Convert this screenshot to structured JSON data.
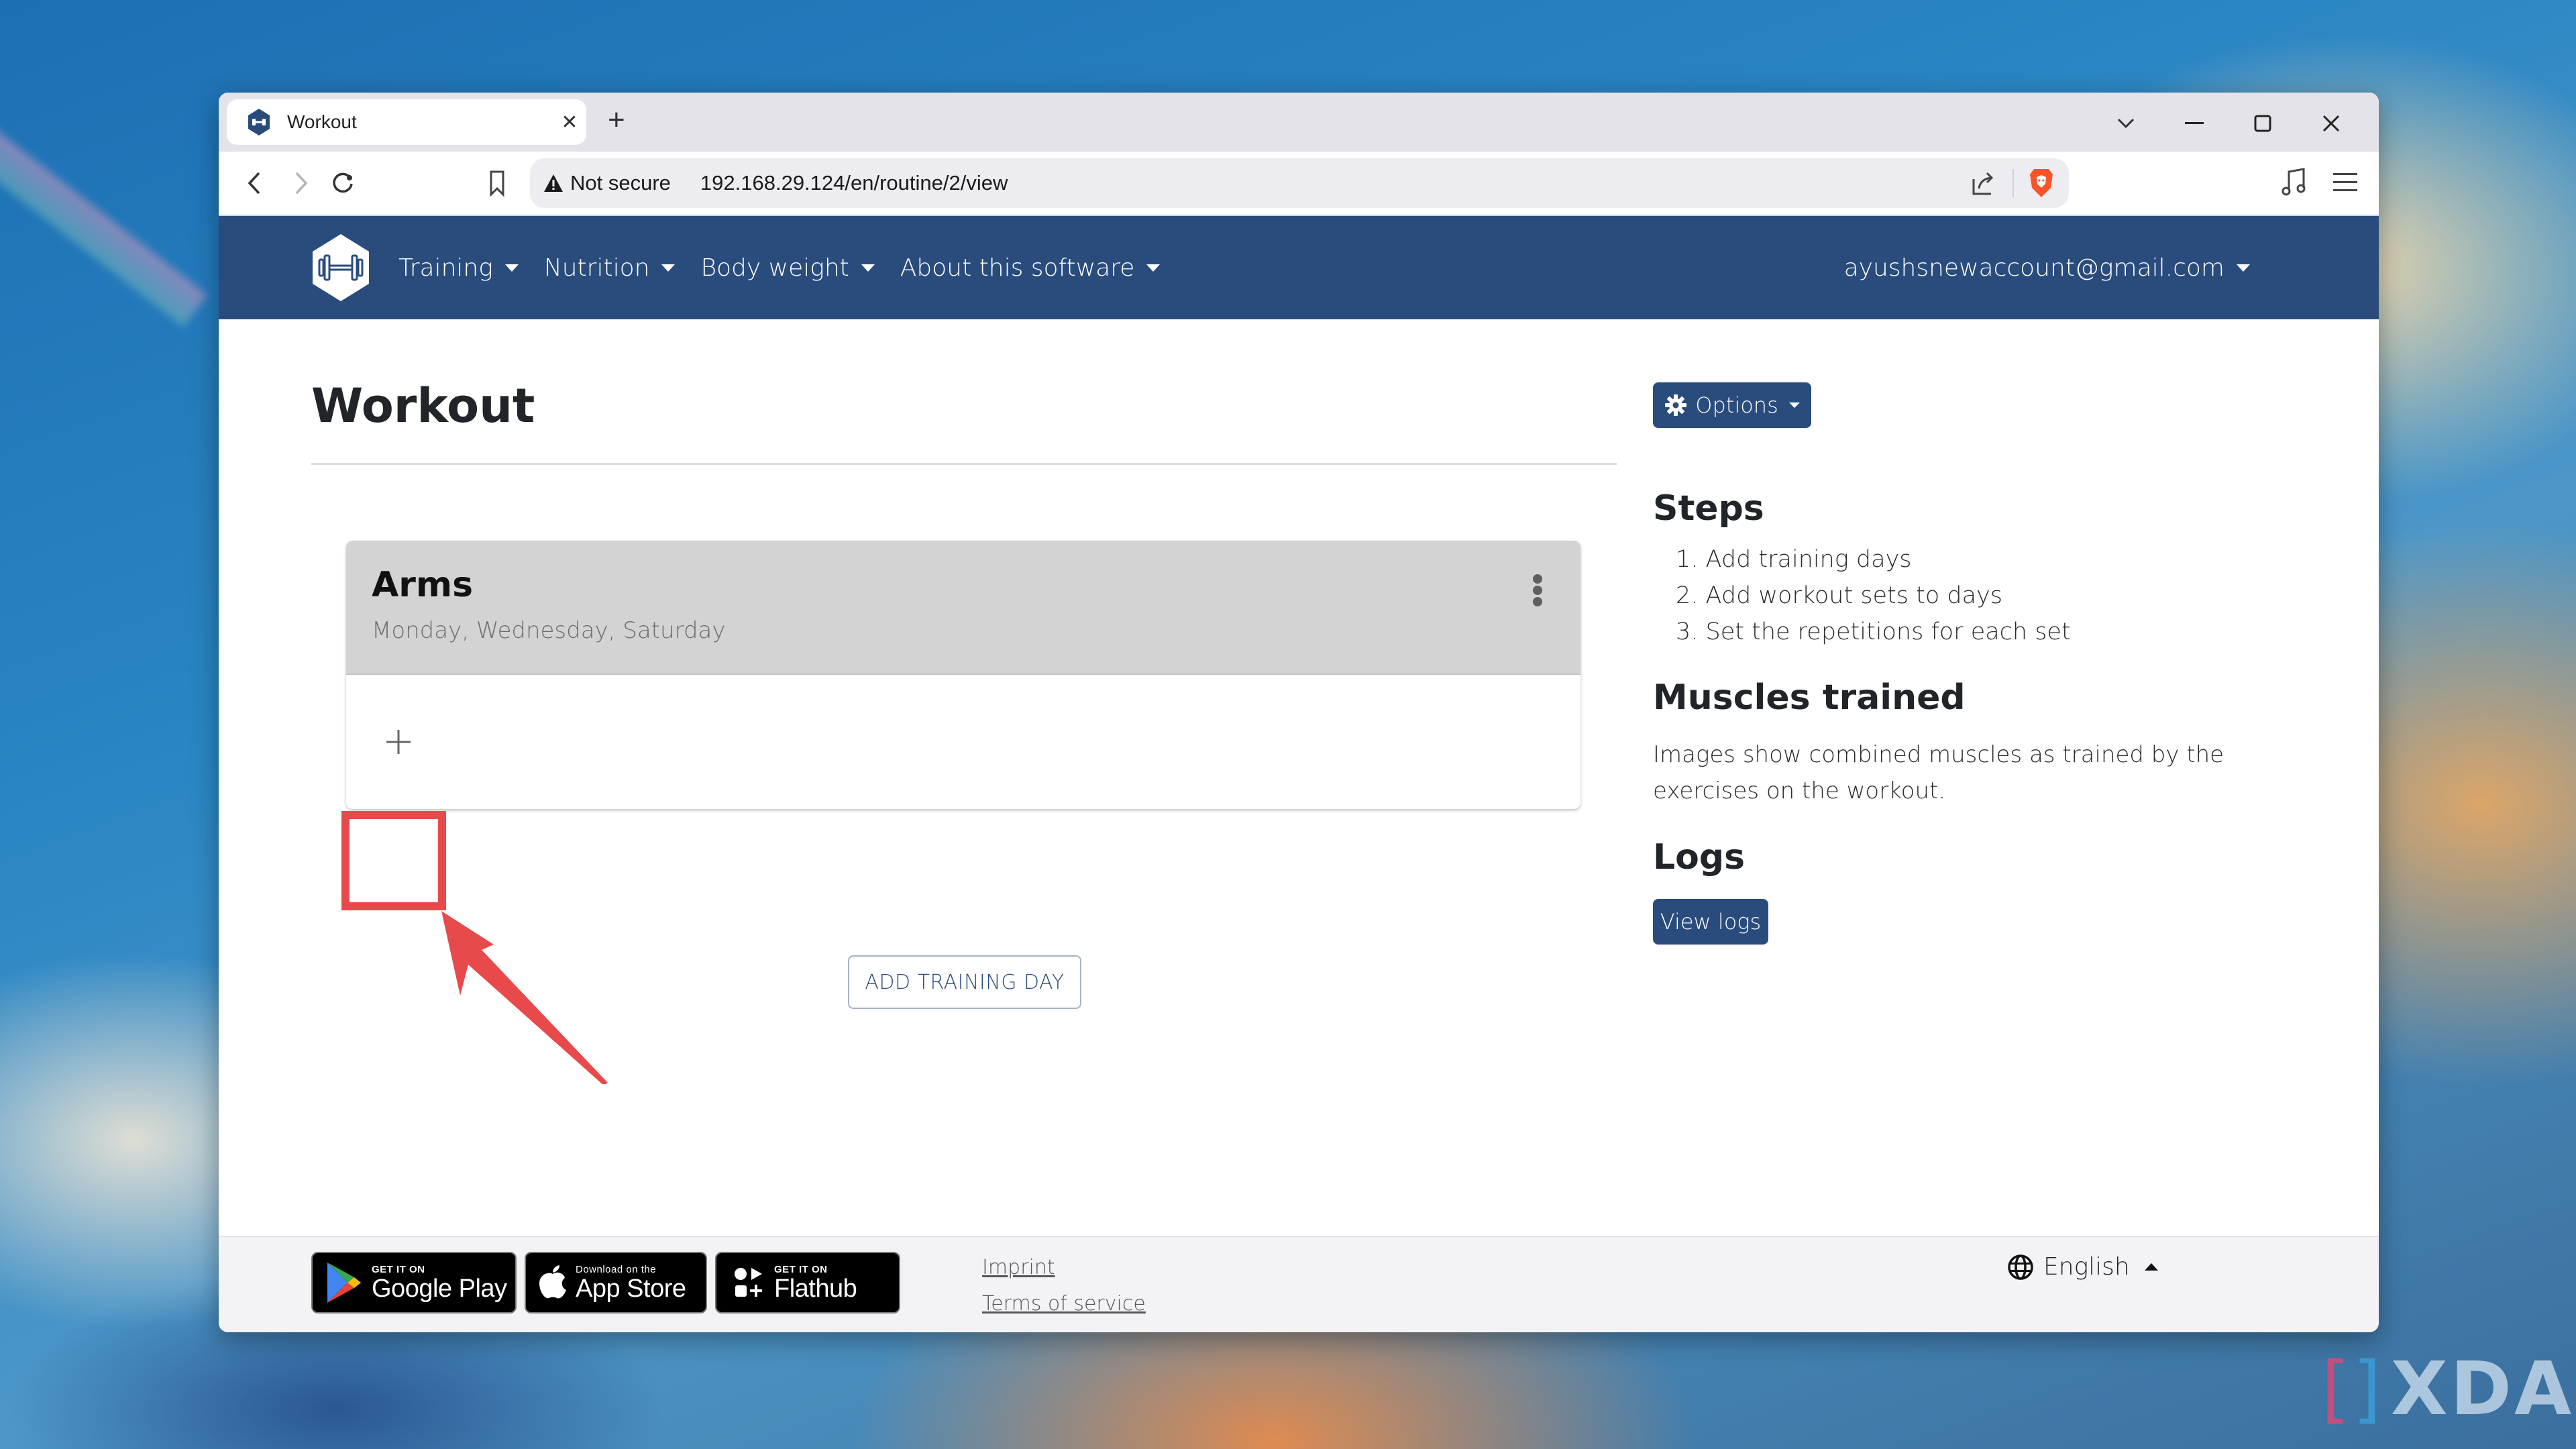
{
  "browser": {
    "tab_title": "Workout",
    "new_tab_label": "+",
    "security_label": "Not secure",
    "url": "192.168.29.124/en/routine/2/view"
  },
  "navbar": {
    "items": [
      {
        "label": "Training"
      },
      {
        "label": "Nutrition"
      },
      {
        "label": "Body weight"
      },
      {
        "label": "About this software"
      }
    ],
    "user": "ayushsnewaccount@gmail.com",
    "brand_color": "#2a4c7d"
  },
  "main": {
    "title": "Workout",
    "day": {
      "name": "Arms",
      "weekdays": "Monday, Wednesday, Saturday",
      "add_set_label": "+"
    },
    "add_training_day_label": "ADD TRAINING DAY"
  },
  "sidebar": {
    "options_label": "Options",
    "steps_heading": "Steps",
    "steps": [
      "1. Add training days",
      "2. Add workout sets to days",
      "3. Set the repetitions for each set"
    ],
    "muscles_heading": "Muscles trained",
    "muscles_text": "Images show combined muscles as trained by the exercises on the workout.",
    "logs_heading": "Logs",
    "view_logs_label": "View logs"
  },
  "footer": {
    "badges": [
      {
        "small": "GET IT ON",
        "big": "Google Play"
      },
      {
        "small": "Download on the",
        "big": "App Store"
      },
      {
        "small": "GET IT ON",
        "big": "Flathub"
      }
    ],
    "links": [
      "Imprint",
      "Terms of service"
    ],
    "language": "English"
  },
  "annotation": {
    "highlight_color": "#e84a4c"
  },
  "watermark": "XDA"
}
